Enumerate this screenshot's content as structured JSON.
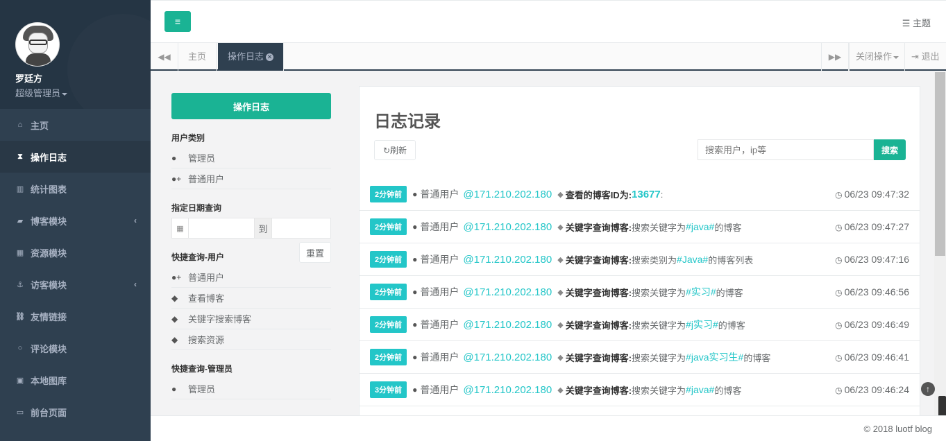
{
  "sidebar": {
    "user_name": "罗廷方",
    "user_role": "超级管理员",
    "items": [
      {
        "label": "主页",
        "icon": "home-icon",
        "glyph": "⌂"
      },
      {
        "label": "操作日志",
        "icon": "hourglass-icon",
        "glyph": "⧗"
      },
      {
        "label": "统计图表",
        "icon": "bar-chart-icon",
        "glyph": "▥"
      },
      {
        "label": "博客模块",
        "icon": "book-icon",
        "glyph": "▰"
      },
      {
        "label": "资源模块",
        "icon": "table-icon",
        "glyph": "▦"
      },
      {
        "label": "访客模块",
        "icon": "anchor-icon",
        "glyph": "⚓"
      },
      {
        "label": "友情链接",
        "icon": "unlink-icon",
        "glyph": "⛓"
      },
      {
        "label": "评论模块",
        "icon": "comment-icon",
        "glyph": "○"
      },
      {
        "label": "本地图库",
        "icon": "picture-icon",
        "glyph": "▣"
      },
      {
        "label": "前台页面",
        "icon": "desktop-icon",
        "glyph": "▭"
      }
    ]
  },
  "topbar": {
    "menu_glyph": "≡",
    "theme_label": "主题"
  },
  "tabs": {
    "back_glyph": "◀◀",
    "forward_glyph": "▶▶",
    "items": [
      {
        "label": "主页"
      },
      {
        "label": "操作日志"
      }
    ],
    "close_ops": "关闭操作",
    "logout": "退出"
  },
  "filters": {
    "main_button": "操作日志",
    "user_type_title": "用户类别",
    "user_types": [
      "管理员",
      "普通用户"
    ],
    "date_title": "指定日期查询",
    "date_to": "到",
    "reset": "重置",
    "quick_user_title": "快捷查询-用户",
    "quick_user_items": [
      "普通用户",
      "查看博客",
      "关键字搜索博客",
      "搜索资源"
    ],
    "quick_admin_title": "快捷查询-管理员",
    "quick_admin_items": [
      "管理员"
    ]
  },
  "log": {
    "title": "日志记录",
    "refresh": "刷新",
    "search_placeholder": "搜索用户，ip等",
    "search_button": "搜索",
    "rows": [
      {
        "badge": "2分钟前",
        "user": "普通用户",
        "ip": "@171.210.202.180",
        "action": "查看的博客ID为:",
        "pre": "",
        "kw": "13677",
        "post": ":",
        "time": "06/23 09:47:32",
        "bold_kw": true
      },
      {
        "badge": "2分钟前",
        "user": "普通用户",
        "ip": "@171.210.202.180",
        "action": "关键字查询博客:",
        "pre": "搜索关键字为",
        "kw": "#java#",
        "post": "的博客",
        "time": "06/23 09:47:27"
      },
      {
        "badge": "2分钟前",
        "user": "普通用户",
        "ip": "@171.210.202.180",
        "action": "关键字查询博客:",
        "pre": "搜索类别为",
        "kw": "#Java#",
        "post": "的博客列表",
        "time": "06/23 09:47:16"
      },
      {
        "badge": "2分钟前",
        "user": "普通用户",
        "ip": "@171.210.202.180",
        "action": "关键字查询博客:",
        "pre": "搜索关键字为",
        "kw": "#实习#",
        "post": "的博客",
        "time": "06/23 09:46:56"
      },
      {
        "badge": "2分钟前",
        "user": "普通用户",
        "ip": "@171.210.202.180",
        "action": "关键字查询博客:",
        "pre": "搜索关键字为",
        "kw": "#j实习#",
        "post": "的博客",
        "time": "06/23 09:46:49"
      },
      {
        "badge": "2分钟前",
        "user": "普通用户",
        "ip": "@171.210.202.180",
        "action": "关键字查询博客:",
        "pre": "搜索关键字为",
        "kw": "#java实习生#",
        "post": "的博客",
        "time": "06/23 09:46:41"
      },
      {
        "badge": "3分钟前",
        "user": "普通用户",
        "ip": "@171.210.202.180",
        "action": "关键字查询博客:",
        "pre": "搜索关键字为",
        "kw": "#java#",
        "post": "的博客",
        "time": "06/23 09:46:24"
      }
    ]
  },
  "footer": {
    "text": "© 2018 luotf blog"
  },
  "colors": {
    "sidebar_bg": "#2f4050",
    "accent": "#1ab394",
    "info": "#23c6c8"
  }
}
